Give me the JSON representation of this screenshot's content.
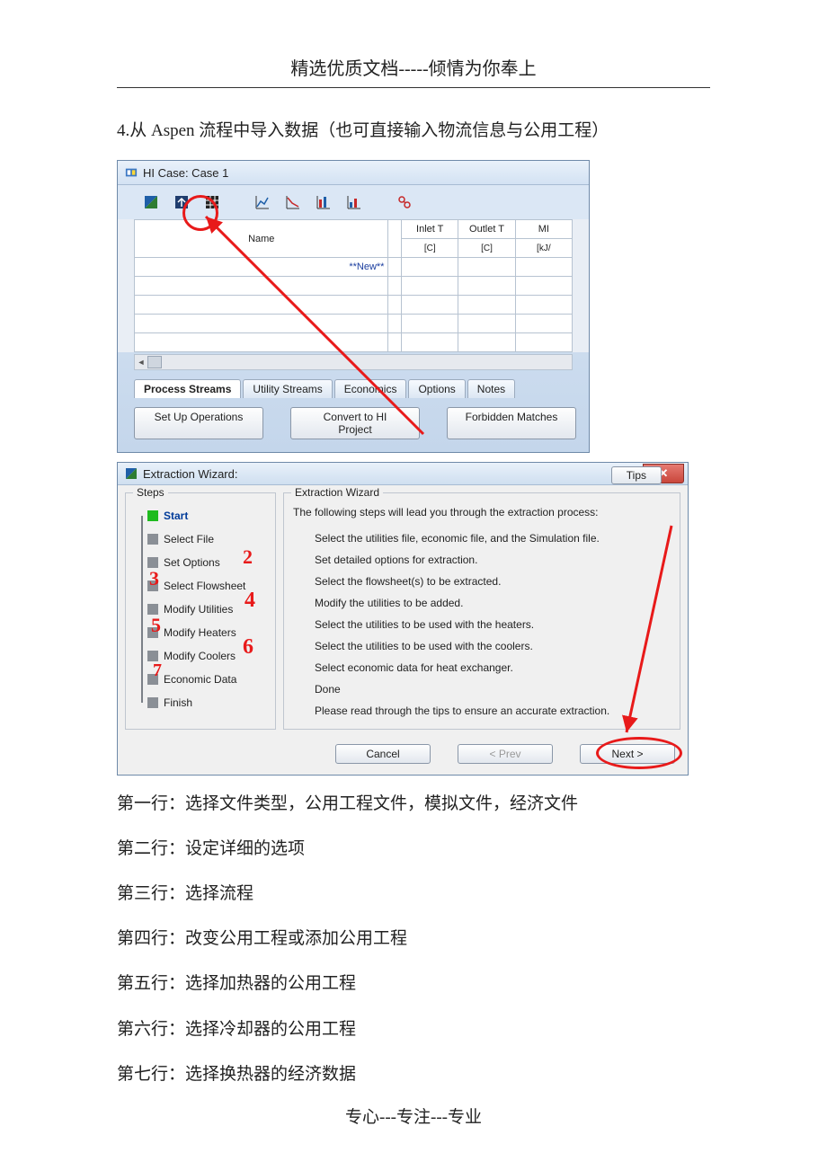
{
  "doc": {
    "header": "精选优质文档-----倾情为你奉上",
    "footer": "专心---专注---专业",
    "intro": "4.从 Aspen 流程中导入数据（也可直接输入物流信息与公用工程）",
    "lines": [
      "第一行：选择文件类型，公用工程文件，模拟文件，经济文件",
      "第二行：设定详细的选项",
      "第三行：选择流程",
      "第四行：改变公用工程或添加公用工程",
      "第五行：选择加热器的公用工程",
      "第六行：选择冷却器的公用工程",
      "第七行：选择换热器的经济数据"
    ]
  },
  "hi": {
    "title": "HI Case: Case 1",
    "columns": {
      "name": "Name",
      "inletT": "Inlet T",
      "inletT_sub": "[C]",
      "outletT": "Outlet T",
      "outletT_sub": "[C]",
      "m": "MI",
      "m_sub": "[kJ/"
    },
    "new_label": "**New**",
    "tabs": [
      "Process Streams",
      "Utility Streams",
      "Economics",
      "Options",
      "Notes"
    ],
    "buttons": {
      "setup": "Set Up Operations",
      "convert": "Convert to HI Project",
      "forbidden": "Forbidden Matches"
    }
  },
  "wiz": {
    "title": "Extraction Wizard:",
    "steps_legend": "Steps",
    "main_legend": "Extraction Wizard",
    "intro": "The following steps will lead you through the extraction process:",
    "steps": [
      {
        "label": "Start",
        "active": true,
        "desc": "Select the utilities file, economic file, and the Simulation file."
      },
      {
        "label": "Select File",
        "desc": "Set detailed options for extraction."
      },
      {
        "label": "Set Options",
        "desc": "Select the flowsheet(s)  to be extracted."
      },
      {
        "label": "Select Flowsheet",
        "desc": "Modify the utilities to be added."
      },
      {
        "label": "Modify Utilities",
        "desc": "Select the utilities to be used with the heaters."
      },
      {
        "label": "Modify Heaters",
        "desc": "Select the utilities to be used with the coolers."
      },
      {
        "label": "Modify Coolers",
        "desc": "Select economic data for heat exchanger."
      },
      {
        "label": "Economic Data",
        "desc": "Done"
      },
      {
        "label": "Finish",
        "desc": "Please read through the tips to ensure an accurate extraction."
      }
    ],
    "tips": "Tips",
    "buttons": {
      "cancel": "Cancel",
      "prev": "< Prev",
      "next": "Next >"
    }
  }
}
